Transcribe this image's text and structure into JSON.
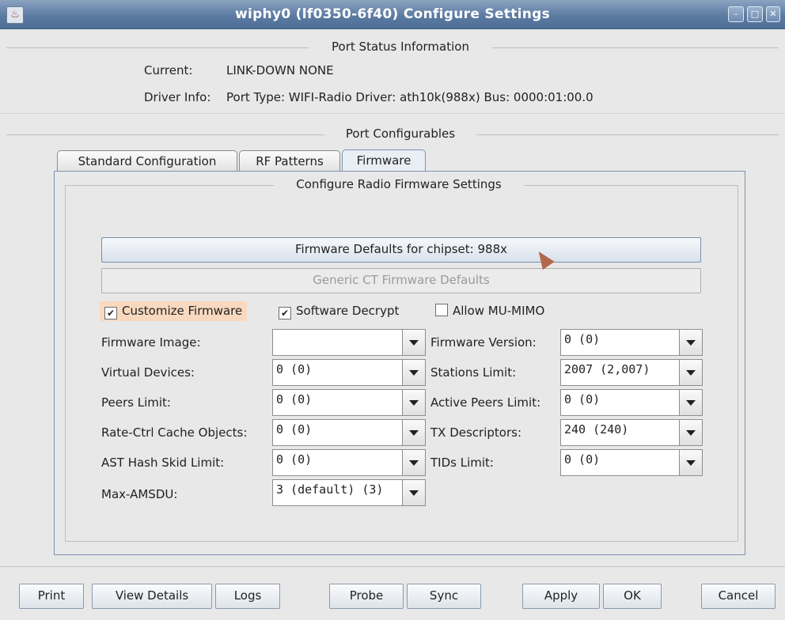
{
  "window": {
    "title": "wiphy0  (lf0350-6f40) Configure Settings"
  },
  "port_status": {
    "title": "Port Status Information",
    "current_label": "Current:",
    "current_value": "LINK-DOWN  NONE",
    "driver_label": "Driver Info:",
    "driver_value": "Port Type: WIFI-Radio   Driver: ath10k(988x)  Bus: 0000:01:00.0"
  },
  "configurables": {
    "title": "Port Configurables"
  },
  "tabs": [
    {
      "label": "Standard Configuration"
    },
    {
      "label": "RF Patterns"
    },
    {
      "label": "Firmware"
    }
  ],
  "firmware": {
    "title": "Configure Radio Firmware Settings",
    "defaults_button": "Firmware Defaults for chipset: 988x",
    "generic_button": "Generic CT Firmware Defaults",
    "checkboxes": {
      "customize": {
        "label": "Customize Firmware",
        "checked": true
      },
      "decrypt": {
        "label": "Software Decrypt",
        "checked": true
      },
      "mumimo": {
        "label": "Allow MU-MIMO",
        "checked": false
      }
    },
    "fields": {
      "firmware_image": {
        "label": "Firmware Image:",
        "value": ""
      },
      "firmware_version": {
        "label": "Firmware Version:",
        "value": "0 (0)"
      },
      "virtual_devices": {
        "label": "Virtual Devices:",
        "value": "0 (0)"
      },
      "stations_limit": {
        "label": "Stations Limit:",
        "value": "2007 (2,007)"
      },
      "peers_limit": {
        "label": "Peers Limit:",
        "value": "0 (0)"
      },
      "active_peers_limit": {
        "label": "Active Peers Limit:",
        "value": "0 (0)"
      },
      "rate_ctrl": {
        "label": "Rate-Ctrl Cache Objects:",
        "value": "0 (0)"
      },
      "tx_descriptors": {
        "label": "TX Descriptors:",
        "value": "240 (240)"
      },
      "ast_hash": {
        "label": "AST Hash Skid Limit:",
        "value": "0 (0)"
      },
      "tids_limit": {
        "label": "TIDs Limit:",
        "value": "0 (0)"
      },
      "max_amsdu": {
        "label": "Max-AMSDU:",
        "value": "3 (default) (3)"
      }
    }
  },
  "buttons": {
    "print": "Print",
    "view_details": "View Details",
    "logs": "Logs",
    "probe": "Probe",
    "sync": "Sync",
    "apply": "Apply",
    "ok": "OK",
    "cancel": "Cancel"
  }
}
